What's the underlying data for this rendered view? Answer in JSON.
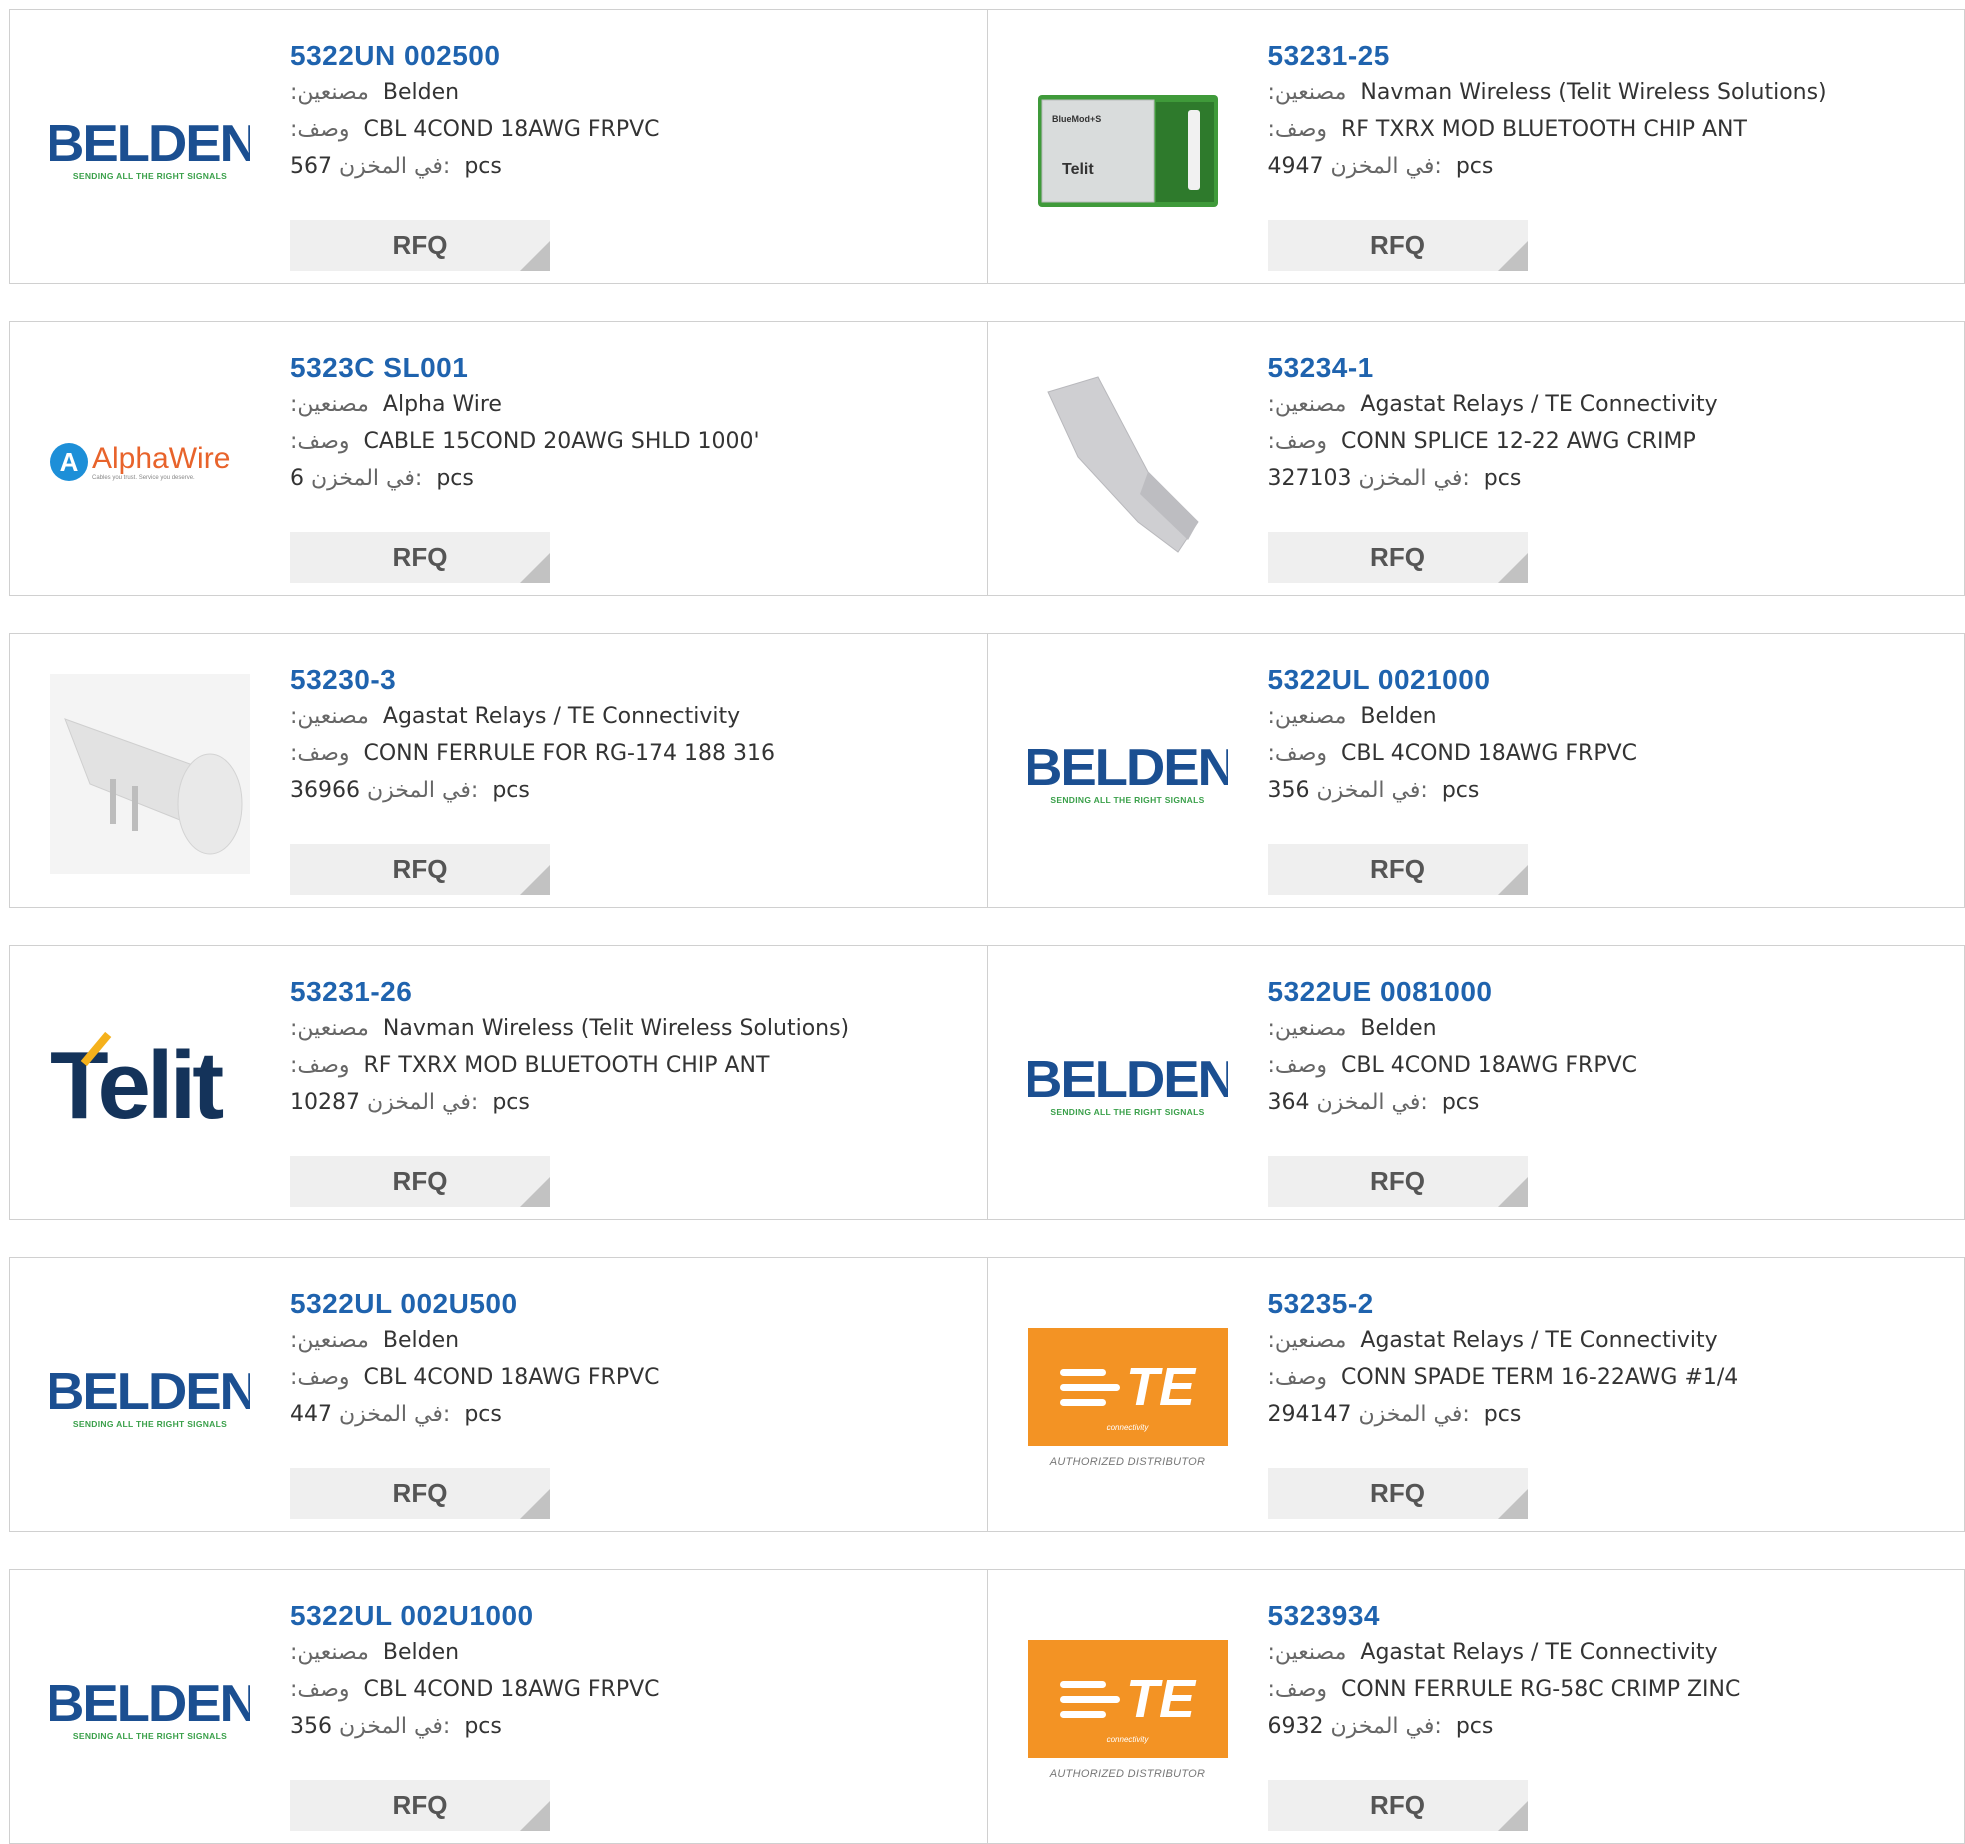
{
  "labels": {
    "manufacturer": ":مصنعين",
    "description": ":وصف",
    "stock": "في المخزن:",
    "unit": "pcs",
    "rfq": "RFQ"
  },
  "products": [
    {
      "part": "5322UN 002500",
      "manufacturer": "Belden",
      "description": "CBL 4COND 18AWG FRPVC",
      "stock": "567",
      "image": "belden-logo"
    },
    {
      "part": "53231-25",
      "manufacturer": "Navman Wireless (Telit Wireless Solutions)",
      "description": "RF TXRX MOD BLUETOOTH CHIP ANT",
      "stock": "4947",
      "image": "bluetooth-module-photo"
    },
    {
      "part": "5323C SL001",
      "manufacturer": "Alpha Wire",
      "description": "CABLE 15COND 20AWG SHLD 1000'",
      "stock": "6",
      "image": "alphawire-logo"
    },
    {
      "part": "53234-1",
      "manufacturer": "Agastat Relays / TE Connectivity",
      "description": "CONN SPLICE 12-22 AWG CRIMP",
      "stock": "327103",
      "image": "splice-photo"
    },
    {
      "part": "53230-3",
      "manufacturer": "Agastat Relays / TE Connectivity",
      "description": "CONN FERRULE FOR RG-174 188 316",
      "stock": "36966",
      "image": "ferrule-photo"
    },
    {
      "part": "5322UL 0021000",
      "manufacturer": "Belden",
      "description": "CBL 4COND 18AWG FRPVC",
      "stock": "356",
      "image": "belden-logo"
    },
    {
      "part": "53231-26",
      "manufacturer": "Navman Wireless (Telit Wireless Solutions)",
      "description": "RF TXRX MOD BLUETOOTH CHIP ANT",
      "stock": "10287",
      "image": "telit-logo"
    },
    {
      "part": "5322UE 0081000",
      "manufacturer": "Belden",
      "description": "CBL 4COND 18AWG FRPVC",
      "stock": "364",
      "image": "belden-logo"
    },
    {
      "part": "5322UL 002U500",
      "manufacturer": "Belden",
      "description": "CBL 4COND 18AWG FRPVC",
      "stock": "447",
      "image": "belden-logo"
    },
    {
      "part": "53235-2",
      "manufacturer": "Agastat Relays / TE Connectivity",
      "description": "CONN SPADE TERM 16-22AWG #1/4",
      "stock": "294147",
      "image": "te-logo"
    },
    {
      "part": "5322UL 002U1000",
      "manufacturer": "Belden",
      "description": "CBL 4COND 18AWG FRPVC",
      "stock": "356",
      "image": "belden-logo"
    },
    {
      "part": "5323934",
      "manufacturer": "Agastat Relays / TE Connectivity",
      "description": "CONN FERRULE RG-58C CRIMP ZINC",
      "stock": "6932",
      "image": "te-logo"
    }
  ],
  "logos": {
    "belden": {
      "word": "BELDEN",
      "tagline": "SENDING ALL THE RIGHT SIGNALS"
    },
    "alphawire": {
      "word": "AlphaWire",
      "tagline": "Cables you trust. Service you deserve."
    },
    "telit": {
      "word": "Telit"
    },
    "te": {
      "word": "TE",
      "sub": "connectivity",
      "dist": "AUTHORIZED DISTRIBUTOR"
    },
    "bluemod": {
      "label": "BlueMod+S",
      "brand": "Telit"
    }
  },
  "colors": {
    "link": "#1f63ae",
    "button_bg": "#efefef",
    "border": "#d0d0d0",
    "te_orange": "#f39324",
    "belden_blue": "#1b4f91"
  }
}
